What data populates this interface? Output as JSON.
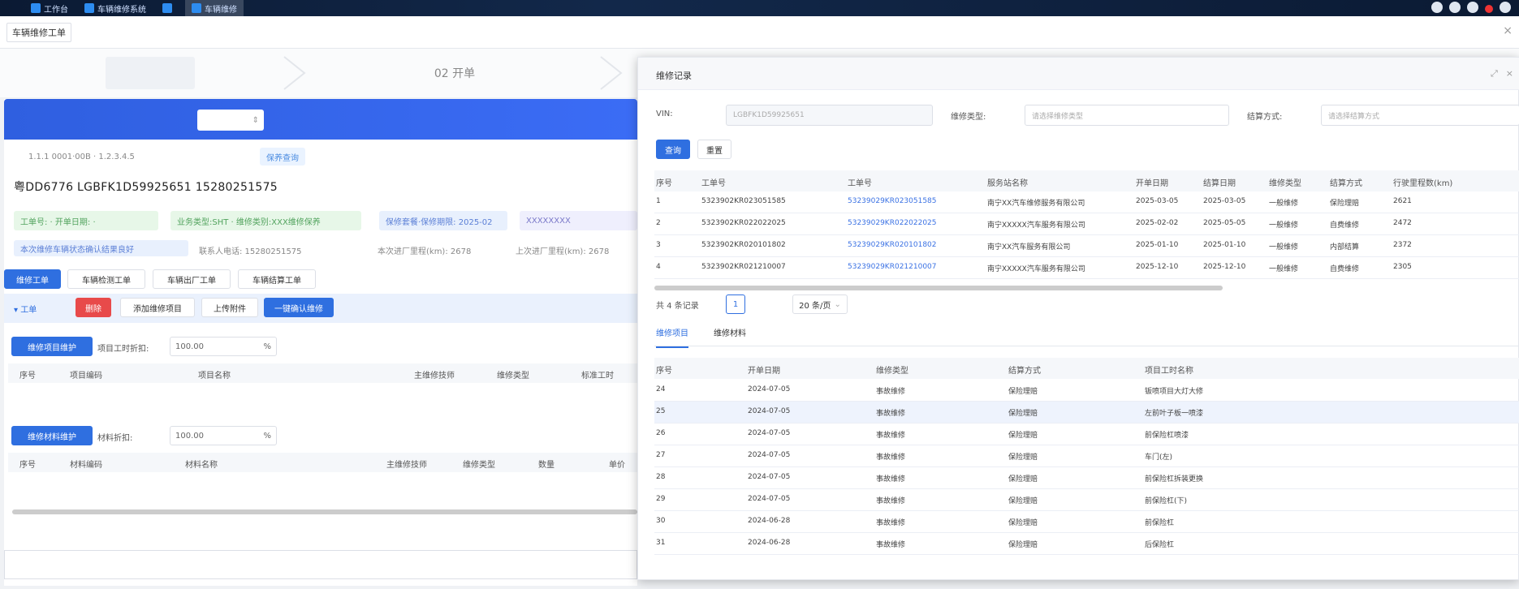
{
  "taskbar": {
    "items": [
      "工作台",
      "车辆维修系统",
      "",
      "车辆维修"
    ]
  },
  "page_tab": {
    "label": "车辆维修工单"
  },
  "steps": {
    "step2": "02 开单"
  },
  "left": {
    "banner_select": "",
    "info_line": "1.1.1 0001·00B · 1.2.3.4.5",
    "info_tag": "保养查询",
    "vehicle_text": "粤DD6776  LGBFK1D59925651  15280251575",
    "tags": [
      "工单号: · 开单日期: ·",
      "业务类型:SHT · 维修类别:XXX维修保养",
      "保修套餐·保修期限: 2025-02",
      "XXXXXXXX"
    ],
    "meta": [
      "本次维修车辆状态确认结果良好",
      "联系人电话: 15280251575",
      "本次进厂里程(km): 2678",
      "上次进厂里程(km): 2678"
    ],
    "tab_buttons": [
      "维修工单",
      "车辆检测工单",
      "车辆出厂工单",
      "车辆结算工单"
    ],
    "toolbar": {
      "expand": "工单",
      "delete": "删除",
      "add_item": "添加维修项目",
      "upload": "上传附件",
      "confirm": "一键确认维修"
    },
    "sec1": {
      "add_btn": "维修项目维护",
      "discount_label": "项目工时折扣:",
      "discount_value": "100.00",
      "unit": "%"
    },
    "sec1_cols": [
      "序号",
      "项目编码",
      "项目名称",
      "主维修技师",
      "维修类型",
      "标准工时"
    ],
    "sec2": {
      "add_btn": "维修材料维护",
      "discount_label": "材料折扣:",
      "discount_value": "100.00",
      "unit": "%"
    },
    "sec2_cols": [
      "序号",
      "材料编码",
      "材料名称",
      "主维修技师",
      "维修类型",
      "数量",
      "单价"
    ]
  },
  "dialog": {
    "title": "维修记录",
    "vin_label": "VIN:",
    "vin_value": "LGBFK1D59925651",
    "type_label": "维修类型:",
    "type_placeholder": "请选择维修类型",
    "method_label": "结算方式:",
    "method_placeholder": "请选择结算方式",
    "search_btn": "查询",
    "reset_btn": "重置",
    "columns": [
      "序号",
      "工单号",
      "工单号",
      "服务站名称",
      "开单日期",
      "结算日期",
      "维修类型",
      "结算方式",
      "行驶里程数(km)"
    ],
    "rows": [
      [
        "1",
        "5323902KR023051585",
        "53239029KR023051585",
        "南宁XX汽车维修服务有限公司",
        "2025-03-05",
        "2025-03-05",
        "一般维修",
        "保险理赔",
        "2621"
      ],
      [
        "2",
        "5323902KR022022025",
        "53239029KR022022025",
        "南宁XXXXX汽车服务有限公司",
        "2025-02-02",
        "2025-05-05",
        "一般维修",
        "自费维修",
        "2472"
      ],
      [
        "3",
        "5323902KR020101802",
        "53239029KR020101802",
        "南宁XX汽车服务有限公司",
        "2025-01-10",
        "2025-01-10",
        "一般维修",
        "内部结算",
        "2372"
      ],
      [
        "4",
        "5323902KR021210007",
        "53239029KR021210007",
        "南宁XXXXX汽车服务有限公司",
        "2025-12-10",
        "2025-12-10",
        "一般维修",
        "自费维修",
        "2305"
      ]
    ],
    "pager": {
      "total": "共 4 条记录",
      "page": "1",
      "size": "20 条/页"
    },
    "subtabs": [
      "维修项目",
      "维修材料"
    ],
    "sub_columns": [
      "序号",
      "开单日期",
      "维修类型",
      "结算方式",
      "项目工时名称"
    ],
    "sub_rows": [
      [
        "24",
        "2024-07-05",
        "事故维修",
        "保险理赔",
        "钣喷项目大灯大修"
      ],
      [
        "25",
        "2024-07-05",
        "事故维修",
        "保险理赔",
        "左前叶子板一喷漆"
      ],
      [
        "26",
        "2024-07-05",
        "事故维修",
        "保险理赔",
        "前保险杠喷漆"
      ],
      [
        "27",
        "2024-07-05",
        "事故维修",
        "保险理赔",
        "车门(左)"
      ],
      [
        "28",
        "2024-07-05",
        "事故维修",
        "保险理赔",
        "前保险杠拆装更换"
      ],
      [
        "29",
        "2024-07-05",
        "事故维修",
        "保险理赔",
        "前保险杠(下)"
      ],
      [
        "30",
        "2024-06-28",
        "事故维修",
        "保险理赔",
        "前保险杠"
      ],
      [
        "31",
        "2024-06-28",
        "事故维修",
        "保险理赔",
        "后保险杠"
      ]
    ]
  }
}
